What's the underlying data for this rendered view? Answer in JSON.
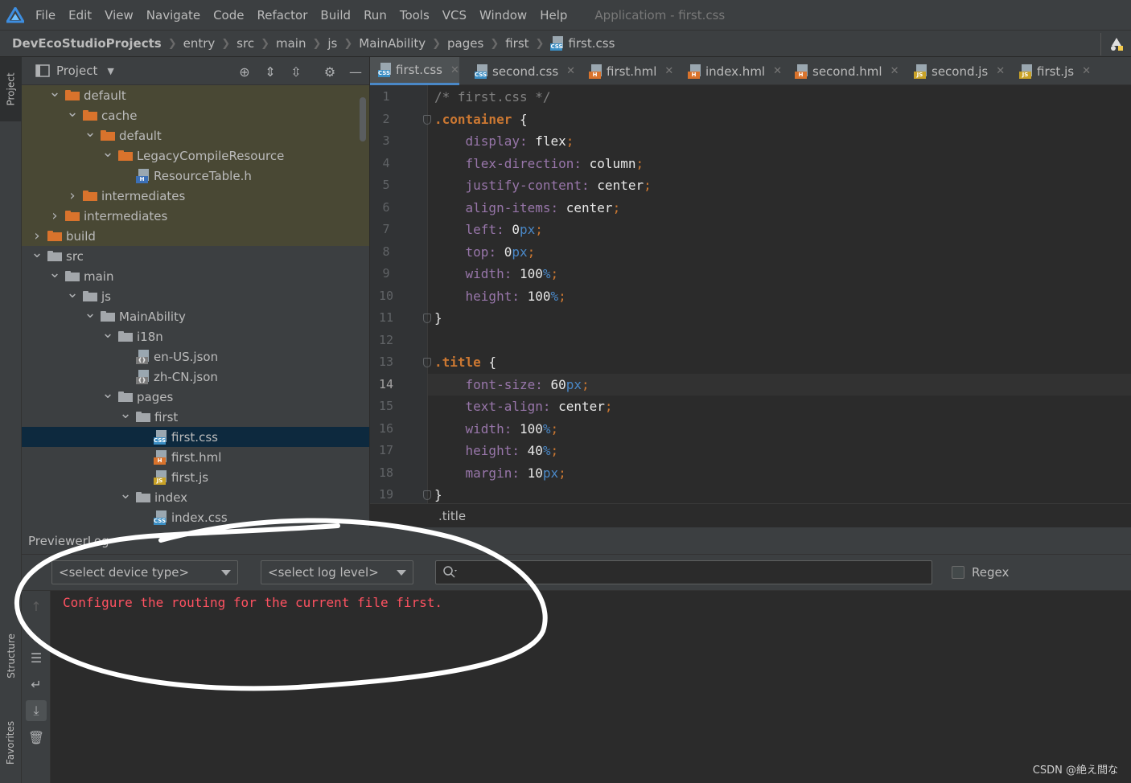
{
  "menu": {
    "items": [
      "File",
      "Edit",
      "View",
      "Navigate",
      "Code",
      "Refactor",
      "Build",
      "Run",
      "Tools",
      "VCS",
      "Window",
      "Help"
    ],
    "app_title": "Applicatiom - first.css"
  },
  "breadcrumb": [
    "DevEcoStudioProjects",
    "entry",
    "src",
    "main",
    "js",
    "MainAbility",
    "pages",
    "first",
    "first.css"
  ],
  "side_tabs": {
    "project": "Project",
    "structure": "Structure",
    "favorites": "Favorites"
  },
  "project_panel": {
    "title": "Project",
    "tree": [
      {
        "label": "default",
        "depth": 3,
        "icon": "folder-orange",
        "expanded": true,
        "olive": true
      },
      {
        "label": "cache",
        "depth": 4,
        "icon": "folder-orange",
        "expanded": true,
        "olive": true
      },
      {
        "label": "default",
        "depth": 5,
        "icon": "folder-orange",
        "expanded": true,
        "olive": true
      },
      {
        "label": "LegacyCompileResource",
        "depth": 6,
        "icon": "folder-orange",
        "expanded": true,
        "olive": true
      },
      {
        "label": "ResourceTable.h",
        "depth": 7,
        "icon": "file-h",
        "olive": true
      },
      {
        "label": "intermediates",
        "depth": 4,
        "icon": "folder-orange",
        "expanded": false,
        "olive": true
      },
      {
        "label": "intermediates",
        "depth": 3,
        "icon": "folder-orange",
        "expanded": false,
        "olive": true
      },
      {
        "label": "build",
        "depth": 2,
        "icon": "folder-orange",
        "expanded": false,
        "olive": true
      },
      {
        "label": "src",
        "depth": 2,
        "icon": "folder-gray",
        "expanded": true
      },
      {
        "label": "main",
        "depth": 3,
        "icon": "folder-gray",
        "expanded": true
      },
      {
        "label": "js",
        "depth": 4,
        "icon": "folder-gray",
        "expanded": true
      },
      {
        "label": "MainAbility",
        "depth": 5,
        "icon": "folder-gray",
        "expanded": true
      },
      {
        "label": "i18n",
        "depth": 6,
        "icon": "folder-gray",
        "expanded": true
      },
      {
        "label": "en-US.json",
        "depth": 7,
        "icon": "file-json"
      },
      {
        "label": "zh-CN.json",
        "depth": 7,
        "icon": "file-json"
      },
      {
        "label": "pages",
        "depth": 6,
        "icon": "folder-gray",
        "expanded": true
      },
      {
        "label": "first",
        "depth": 7,
        "icon": "folder-gray",
        "expanded": true
      },
      {
        "label": "first.css",
        "depth": 8,
        "icon": "file-css",
        "selected": true
      },
      {
        "label": "first.hml",
        "depth": 8,
        "icon": "file-hml"
      },
      {
        "label": "first.js",
        "depth": 8,
        "icon": "file-js"
      },
      {
        "label": "index",
        "depth": 7,
        "icon": "folder-gray",
        "expanded": true
      },
      {
        "label": "index.css",
        "depth": 8,
        "icon": "file-css"
      }
    ]
  },
  "tabs": [
    {
      "label": "first.css",
      "icon": "file-css",
      "active": true
    },
    {
      "label": "second.css",
      "icon": "file-css"
    },
    {
      "label": "first.hml",
      "icon": "file-hml"
    },
    {
      "label": "index.hml",
      "icon": "file-hml"
    },
    {
      "label": "second.hml",
      "icon": "file-hml"
    },
    {
      "label": "second.js",
      "icon": "file-js"
    },
    {
      "label": "first.js",
      "icon": "file-js"
    }
  ],
  "editor": {
    "current_line": 14,
    "lines": [
      [
        {
          "t": "/* first.css */",
          "c": "com"
        }
      ],
      [
        {
          "t": ".container",
          "c": "sel"
        },
        {
          "t": " {",
          "c": "val"
        }
      ],
      [
        {
          "t": "    "
        },
        {
          "t": "display",
          "c": "prop"
        },
        {
          "t": ": ",
          "c": "prop"
        },
        {
          "t": "flex",
          "c": "val"
        },
        {
          "t": ";",
          "c": "pun"
        }
      ],
      [
        {
          "t": "    "
        },
        {
          "t": "flex-direction",
          "c": "prop"
        },
        {
          "t": ": ",
          "c": "prop"
        },
        {
          "t": "column",
          "c": "val"
        },
        {
          "t": ";",
          "c": "pun"
        }
      ],
      [
        {
          "t": "    "
        },
        {
          "t": "justify-content",
          "c": "prop"
        },
        {
          "t": ": ",
          "c": "prop"
        },
        {
          "t": "center",
          "c": "val"
        },
        {
          "t": ";",
          "c": "pun"
        }
      ],
      [
        {
          "t": "    "
        },
        {
          "t": "align-items",
          "c": "prop"
        },
        {
          "t": ": ",
          "c": "prop"
        },
        {
          "t": "center",
          "c": "val"
        },
        {
          "t": ";",
          "c": "pun"
        }
      ],
      [
        {
          "t": "    "
        },
        {
          "t": "left",
          "c": "prop"
        },
        {
          "t": ": ",
          "c": "prop"
        },
        {
          "t": "0",
          "c": "val"
        },
        {
          "t": "px",
          "c": "unit"
        },
        {
          "t": ";",
          "c": "pun"
        }
      ],
      [
        {
          "t": "    "
        },
        {
          "t": "top",
          "c": "prop"
        },
        {
          "t": ": ",
          "c": "prop"
        },
        {
          "t": "0",
          "c": "val"
        },
        {
          "t": "px",
          "c": "unit"
        },
        {
          "t": ";",
          "c": "pun"
        }
      ],
      [
        {
          "t": "    "
        },
        {
          "t": "width",
          "c": "prop"
        },
        {
          "t": ": ",
          "c": "prop"
        },
        {
          "t": "100",
          "c": "val"
        },
        {
          "t": "%",
          "c": "unit"
        },
        {
          "t": ";",
          "c": "pun"
        }
      ],
      [
        {
          "t": "    "
        },
        {
          "t": "height",
          "c": "prop"
        },
        {
          "t": ": ",
          "c": "prop"
        },
        {
          "t": "100",
          "c": "val"
        },
        {
          "t": "%",
          "c": "unit"
        },
        {
          "t": ";",
          "c": "pun"
        }
      ],
      [
        {
          "t": "}",
          "c": "val"
        }
      ],
      [],
      [
        {
          "t": ".title",
          "c": "sel"
        },
        {
          "t": " {",
          "c": "val"
        }
      ],
      [
        {
          "t": "    "
        },
        {
          "t": "font-size",
          "c": "prop"
        },
        {
          "t": ": ",
          "c": "prop"
        },
        {
          "t": "60",
          "c": "val"
        },
        {
          "t": "px",
          "c": "unit"
        },
        {
          "t": ";",
          "c": "pun"
        }
      ],
      [
        {
          "t": "    "
        },
        {
          "t": "text-align",
          "c": "prop"
        },
        {
          "t": ": ",
          "c": "prop"
        },
        {
          "t": "center",
          "c": "val"
        },
        {
          "t": ";",
          "c": "pun"
        }
      ],
      [
        {
          "t": "    "
        },
        {
          "t": "width",
          "c": "prop"
        },
        {
          "t": ": ",
          "c": "prop"
        },
        {
          "t": "100",
          "c": "val"
        },
        {
          "t": "%",
          "c": "unit"
        },
        {
          "t": ";",
          "c": "pun"
        }
      ],
      [
        {
          "t": "    "
        },
        {
          "t": "height",
          "c": "prop"
        },
        {
          "t": ": ",
          "c": "prop"
        },
        {
          "t": "40",
          "c": "val"
        },
        {
          "t": "%",
          "c": "unit"
        },
        {
          "t": ";",
          "c": "pun"
        }
      ],
      [
        {
          "t": "    "
        },
        {
          "t": "margin",
          "c": "prop"
        },
        {
          "t": ": ",
          "c": "prop"
        },
        {
          "t": "10",
          "c": "val"
        },
        {
          "t": "px",
          "c": "unit"
        },
        {
          "t": ";",
          "c": "pun"
        }
      ],
      [
        {
          "t": "}",
          "c": "val"
        }
      ]
    ],
    "fold_lines": [
      2,
      11,
      13,
      19
    ],
    "structure_crumb": ".title"
  },
  "previewer_log": {
    "title": "PreviewerLog",
    "device_type_placeholder": "<select device type>",
    "log_level_placeholder": "<select log level>",
    "search_value": "",
    "regex_label": "Regex",
    "message": "Configure the routing for the current file first."
  },
  "watermark": "CSDN @絶え間な",
  "colors": {
    "accent": "#4a88c7",
    "error_text": "#ff5261",
    "selected_row": "#0d293e",
    "annotation_stroke": "#ffffff"
  }
}
